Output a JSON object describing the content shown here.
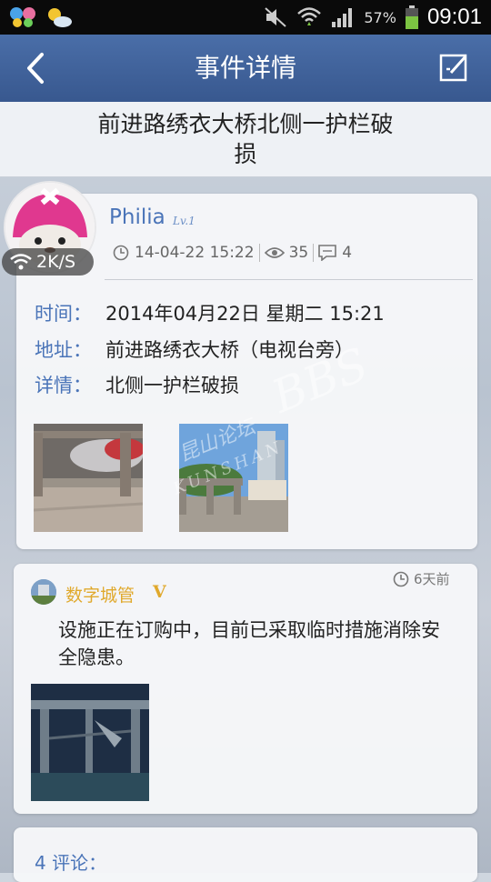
{
  "status_bar": {
    "battery_percent": "57%",
    "time": "09:01",
    "icons": [
      "butterfly-icon",
      "weather-icon",
      "mute-icon",
      "wifi-icon",
      "signal-icon",
      "battery-icon"
    ]
  },
  "app_bar": {
    "title": "事件详情",
    "back_icon": "back-arrow-icon",
    "edit_icon": "edit-icon"
  },
  "event": {
    "title": "前进路绣衣大桥北侧一护栏破损"
  },
  "post": {
    "username": "Philia",
    "level": "Lv.1",
    "network_speed": "2K/S",
    "date": "14-04-22 15:22",
    "views": "35",
    "comments_count": "4",
    "fields": {
      "time_label": "时间：",
      "time_value": "2014年04月22日 星期二 15:21",
      "address_label": "地址：",
      "address_value": "前进路绣衣大桥（电视台旁）",
      "detail_label": "详情：",
      "detail_value": "北侧一护栏破损"
    },
    "watermark": "昆山论坛 KUNSHAN BBS"
  },
  "reply": {
    "author": "数字城管",
    "badge": "V",
    "time": "6天前",
    "text": "设施正在订购中，目前已采取临时措施消除安全隐患。"
  },
  "comments": {
    "title": "4 评论："
  },
  "colors": {
    "app_bar": "#3f629c",
    "accent_blue": "#4a74b8",
    "accent_gold": "#e0a92d"
  }
}
